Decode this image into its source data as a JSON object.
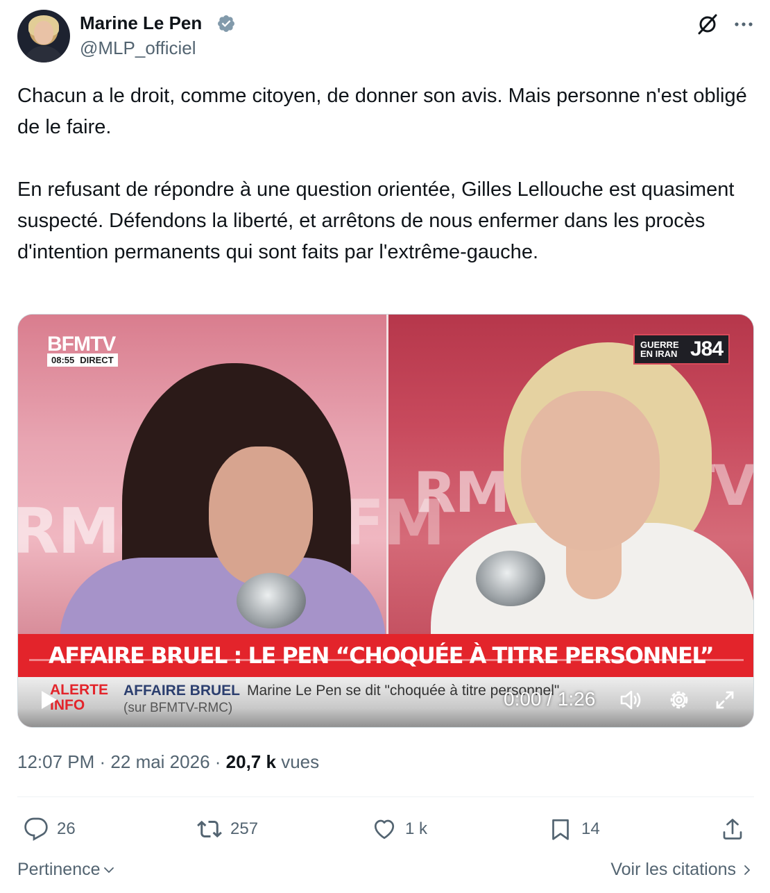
{
  "author": {
    "name": "Marine Le Pen",
    "handle": "@MLP_officiel"
  },
  "tweet": {
    "paragraphs": [
      "Chacun a le droit, comme citoyen, de donner son avis. Mais personne n'est obligé de le faire.",
      "En refusant de répondre à une question orientée, Gilles Lellouche est quasiment suspecté. Défendons la liberté, et arrêtons de nous enfermer dans les procès d'intention permanents qui sont faits par l'extrême-gauche."
    ]
  },
  "video": {
    "channel_logo": "BFMTV",
    "clock": "08:55",
    "live_label": "DIRECT",
    "bg_left": "RMC",
    "bg_left2": "BFM",
    "bg_right": "RMC",
    "bg_right2": "TV.",
    "topic_label": "GUERRE EN IRAN",
    "topic_day": "J84",
    "headline": "AFFAIRE BRUEL : LE PEN “CHOQUÉE À TITRE PERSONNEL”",
    "ticker_alert": "ALERTE INFO",
    "ticker_title": "AFFAIRE BRUEL",
    "ticker_text": "Marine Le Pen se dit \"choquée à titre personnel\"",
    "ticker_sub": "(sur BFMTV-RMC)",
    "time_display": "0:00 / 1:26"
  },
  "meta": {
    "time": "12:07 PM",
    "date": "22 mai 2026",
    "views_count": "20,7 k",
    "views_label": "vues"
  },
  "actions": {
    "replies": "26",
    "retweets": "257",
    "likes": "1 k",
    "bookmarks": "14"
  },
  "footer": {
    "sort_label": "Pertinence",
    "quotes_link": "Voir les citations"
  },
  "colors": {
    "text": "#0f1419",
    "secondary": "#536471",
    "verified": "#829aab",
    "headline_red": "#e3242b"
  },
  "icons": [
    "verified-badge-icon",
    "grok-icon",
    "more-icon",
    "play-icon",
    "volume-icon",
    "settings-icon",
    "fullscreen-icon",
    "reply-icon",
    "retweet-icon",
    "like-icon",
    "bookmark-icon",
    "share-icon",
    "chevron-down-icon",
    "chevron-right-icon"
  ]
}
